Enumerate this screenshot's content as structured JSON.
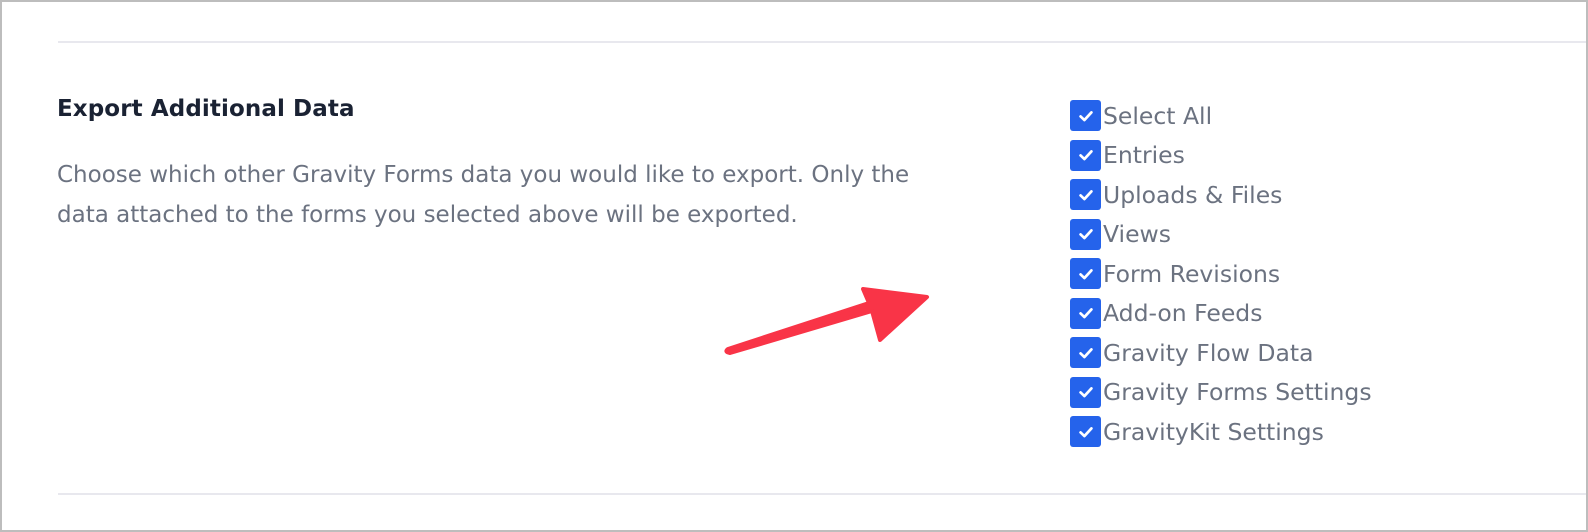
{
  "section": {
    "title": "Export Additional Data",
    "description": "Choose which other Gravity Forms data you would like to export. Only the data attached to the forms you selected above will be exported."
  },
  "options": [
    {
      "label": "Select All",
      "checked": true
    },
    {
      "label": "Entries",
      "checked": true
    },
    {
      "label": "Uploads & Files",
      "checked": true
    },
    {
      "label": "Views",
      "checked": true
    },
    {
      "label": "Form Revisions",
      "checked": true
    },
    {
      "label": "Add-on Feeds",
      "checked": true
    },
    {
      "label": "Gravity Flow Data",
      "checked": true
    },
    {
      "label": "Gravity Forms Settings",
      "checked": true
    },
    {
      "label": "GravityKit Settings",
      "checked": true
    }
  ],
  "icons": {
    "checkbox_check": "check-icon",
    "annotation": "arrow-icon"
  },
  "colors": {
    "checkbox": "#2563eb",
    "annotation_arrow": "#f93447",
    "title_text": "#1a2233",
    "body_text": "#6b7280"
  }
}
